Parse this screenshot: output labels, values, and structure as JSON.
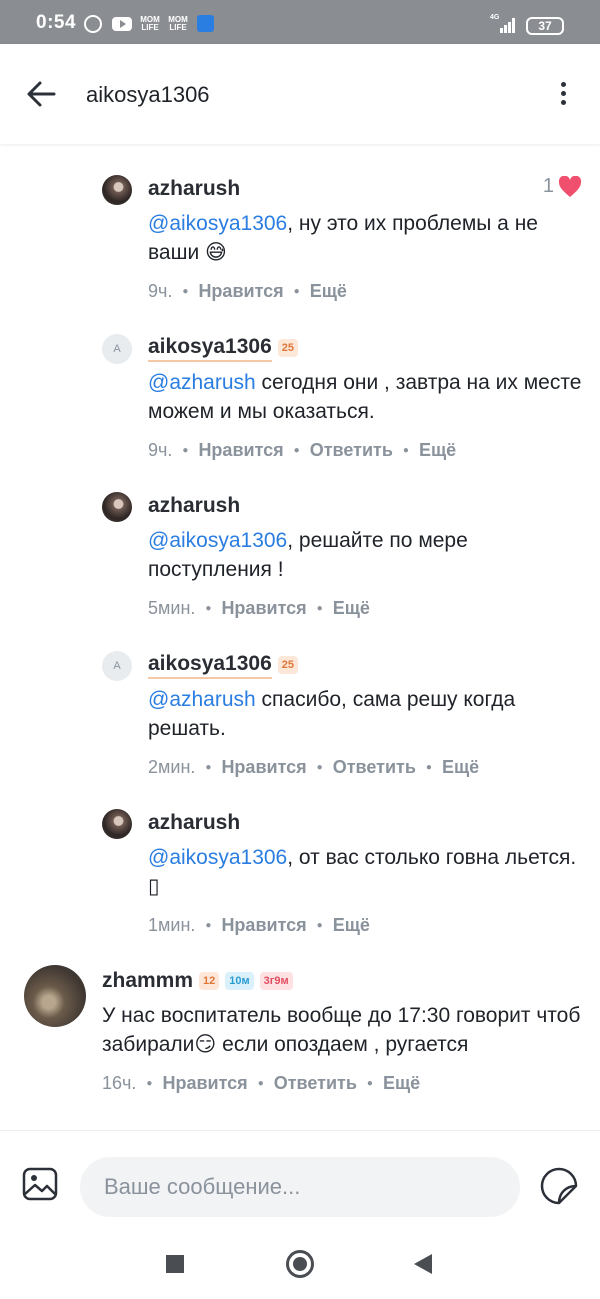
{
  "status_bar": {
    "time": "0:54",
    "icons": [
      "alarm-icon",
      "youtube-icon",
      "mom-life-icon",
      "mom-life-icon",
      "shield-icon"
    ],
    "mom_label": "MOM LIFE",
    "network": "4G",
    "battery": "37"
  },
  "header": {
    "title": "aikosya1306",
    "back_icon": "arrow-left-icon",
    "menu_icon": "more-vertical-icon"
  },
  "comments": [
    {
      "username": "azharush",
      "mention": "@aikosya1306",
      "text": ", ну это их проблемы а не ваши 😅",
      "time": "9ч.",
      "like_label": "Нравится",
      "more_label": "Ещё",
      "likes": "1",
      "liked": true
    },
    {
      "username": "aikosya1306",
      "avatar_letter": "A",
      "badge": "25",
      "mention": "@azharush",
      "text": " сегодня они , завтра на их месте можем и мы оказаться.",
      "time": "9ч.",
      "like_label": "Нравится",
      "reply_label": "Ответить",
      "more_label": "Ещё"
    },
    {
      "username": "azharush",
      "mention": "@aikosya1306",
      "text": ", решайте по мере поступления !",
      "time": "5мин.",
      "like_label": "Нравится",
      "more_label": "Ещё"
    },
    {
      "username": "aikosya1306",
      "avatar_letter": "A",
      "badge": "25",
      "mention": "@azharush",
      "text": " спасибо, сама решу когда решать.",
      "time": "2мин.",
      "like_label": "Нравится",
      "reply_label": "Ответить",
      "more_label": "Ещё"
    },
    {
      "username": "azharush",
      "mention": "@aikosya1306",
      "text": ",  от вас столько говна льется. ▯",
      "time": "1мин.",
      "like_label": "Нравится",
      "more_label": "Ещё"
    },
    {
      "username": "zhammm",
      "badges": [
        "12",
        "10м",
        "3г9м"
      ],
      "text": "У нас воспитатель вообще до 17:30 говорит чтоб забирали😏 если опоздаем , ругается",
      "time": "16ч.",
      "like_label": "Нравится",
      "reply_label": "Ответить",
      "more_label": "Ещё"
    }
  ],
  "composer": {
    "placeholder": "Ваше сообщение...",
    "image_icon": "image-icon",
    "sticker_icon": "sticker-icon"
  },
  "nav": {
    "recents_icon": "square-icon",
    "home_icon": "circle-home-icon",
    "back_icon": "triangle-back-icon"
  },
  "colors": {
    "mention": "#2a7de1",
    "heart": "#f0506e",
    "status_bar": "#8a8d92",
    "badge_orange": "#e0783a",
    "badge_blue": "#2a9bd1",
    "badge_pink": "#e04e60"
  }
}
